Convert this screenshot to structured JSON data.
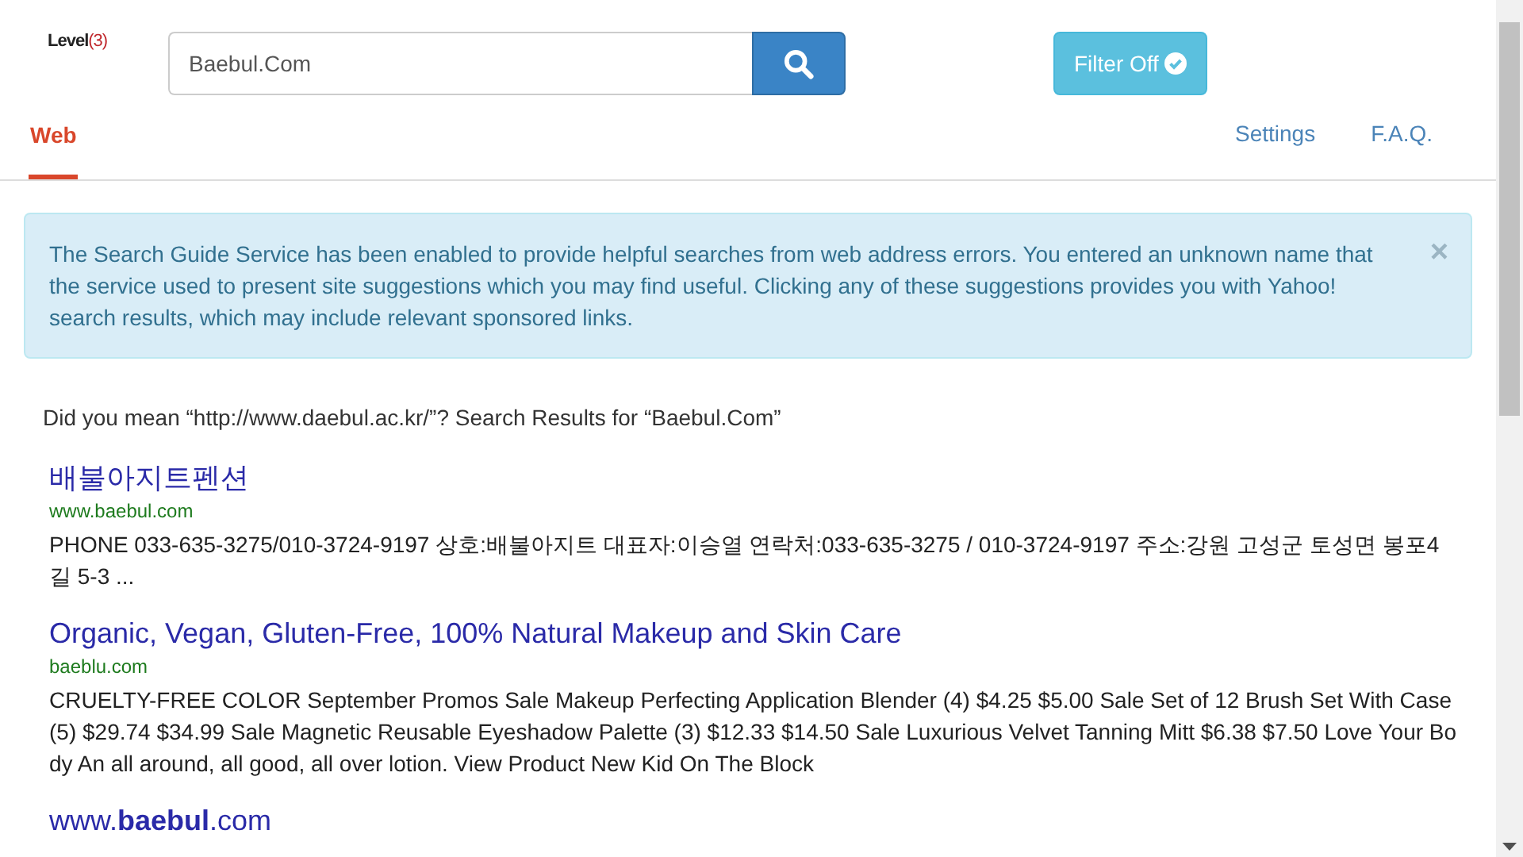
{
  "logo": {
    "name": "Level",
    "mark": "(3)"
  },
  "search": {
    "value": "Baebul.Com"
  },
  "filter_button": {
    "label": "Filter Off",
    "on": false
  },
  "tabs": [
    {
      "label": "Web",
      "selected": true
    }
  ],
  "links": [
    "Settings",
    "F.A.Q."
  ],
  "alert": {
    "text": "The Search Guide Service has been enabled to provide helpful searches from web address errors. You entered an unknown name that the service used to present site suggestions which you may find useful. Clicking any of these suggestions provides you with Yahoo! search results, which may include relevant sponsored links.",
    "close": "×"
  },
  "suggestion": "Did you mean “http://www.daebul.ac.kr/”? Search Results for “Baebul.Com”",
  "results": [
    {
      "title": "배불아지트펜션",
      "url": "www.baebul.com",
      "description": "PHONE 033-635-3275/010-3724-9197 상호:배불아지트 대표자:이승열 연락처:033-635-3275 / 010-3724-9197 주소:강원 고성군 토성면 봉포4길 5-3 ..."
    },
    {
      "title": "Organic, Vegan, Gluten-Free, 100% Natural Makeup and Skin Care",
      "url": "baeblu.com",
      "description": "CRUELTY-FREE COLOR September Promos Sale Makeup Perfecting Application Blender (4) $4.25 $5.00 Sale Set of 12 Brush Set With Case (5) $29.74 $34.99 Sale Magnetic Reusable Eyeshadow Palette (3) $12.33 $14.50 Sale Luxurious Velvet Tanning Mitt $6.38 $7.50 Love Your Body An all around, all good, all over lotion. View Product New Kid On The Block"
    },
    {
      "title": "www.**baebul**.com"
    }
  ]
}
